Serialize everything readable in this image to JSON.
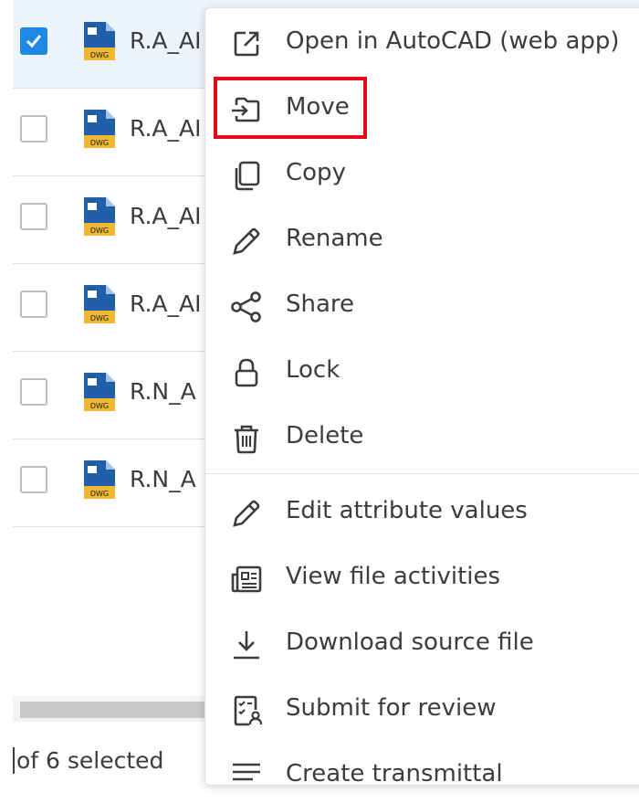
{
  "file_list": {
    "rows": [
      {
        "name": "R.A_AI",
        "checked": true,
        "file_type": "DWG"
      },
      {
        "name": "R.A_AI",
        "checked": false,
        "file_type": "DWG"
      },
      {
        "name": "R.A_AI",
        "checked": false,
        "file_type": "DWG"
      },
      {
        "name": "R.A_AI",
        "checked": false,
        "file_type": "DWG"
      },
      {
        "name": "R.N_A",
        "checked": false,
        "file_type": "DWG"
      },
      {
        "name": "R.N_A",
        "checked": false,
        "file_type": "DWG"
      }
    ],
    "selection_text": "of 6 selected"
  },
  "context_menu": {
    "items": [
      {
        "label": "Open in AutoCAD (web app)",
        "icon": "open-external-icon"
      },
      {
        "label": "Move",
        "icon": "move-folder-icon",
        "highlighted": true
      },
      {
        "label": "Copy",
        "icon": "copy-icon"
      },
      {
        "label": "Rename",
        "icon": "pencil-icon"
      },
      {
        "label": "Share",
        "icon": "share-icon"
      },
      {
        "label": "Lock",
        "icon": "lock-icon"
      },
      {
        "label": "Delete",
        "icon": "trash-icon"
      },
      {
        "label": "Edit attribute values",
        "icon": "pencil-icon"
      },
      {
        "label": "View file activities",
        "icon": "activity-icon"
      },
      {
        "label": "Download source file",
        "icon": "download-icon"
      },
      {
        "label": "Submit for review",
        "icon": "review-icon"
      },
      {
        "label": "Create transmittal",
        "icon": "transmittal-icon"
      }
    ]
  },
  "colors": {
    "accent": "#1e88e5",
    "highlight_box": "#e30613",
    "selected_row": "#eef4fb"
  }
}
